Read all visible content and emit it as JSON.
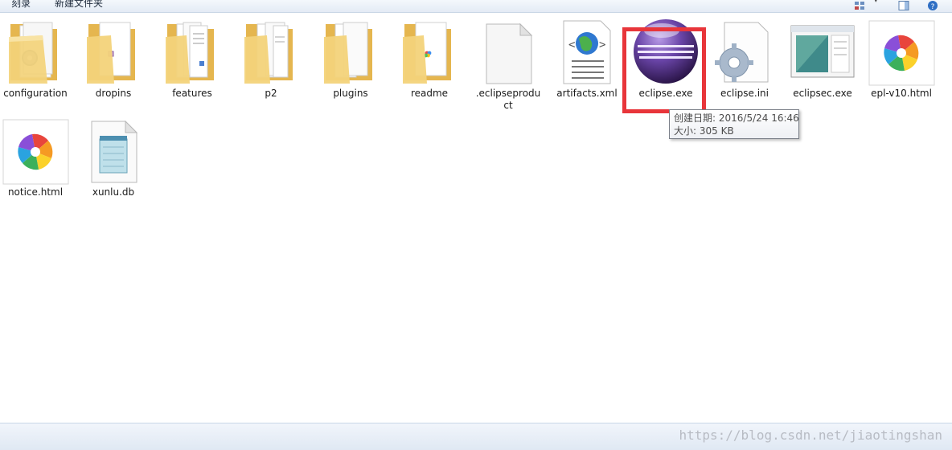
{
  "toolbar": {
    "burn_label": "刻录",
    "new_folder_label": "新建文件夹"
  },
  "files": [
    {
      "name": "configuration",
      "icon": "folder-icon"
    },
    {
      "name": "dropins",
      "icon": "folder-icon"
    },
    {
      "name": "features",
      "icon": "folder-icon"
    },
    {
      "name": "p2",
      "icon": "folder-icon"
    },
    {
      "name": "plugins",
      "icon": "folder-icon"
    },
    {
      "name": "readme",
      "icon": "folder-icon"
    },
    {
      "name": ".eclipseproduct",
      "icon": "blank-file-icon"
    },
    {
      "name": "artifacts.xml",
      "icon": "xml-file-icon"
    },
    {
      "name": "eclipse.exe",
      "icon": "eclipse-icon"
    },
    {
      "name": "eclipse.ini",
      "icon": "config-file-icon"
    },
    {
      "name": "eclipsec.exe",
      "icon": "window-exe-icon"
    },
    {
      "name": "epl-v10.html",
      "icon": "browser-html-icon"
    },
    {
      "name": "notice.html",
      "icon": "browser-html-icon"
    },
    {
      "name": "xunlu.db",
      "icon": "notepad-file-icon"
    }
  ],
  "tooltip": {
    "created": "创建日期: 2016/5/24 16:46",
    "size": "大小: 305 KB"
  },
  "watermark": "https://blog.csdn.net/jiaotingshan",
  "colors": {
    "highlight": "#e8353a",
    "folder": "#f0cf6e",
    "eclipse": "#5a3a96"
  }
}
